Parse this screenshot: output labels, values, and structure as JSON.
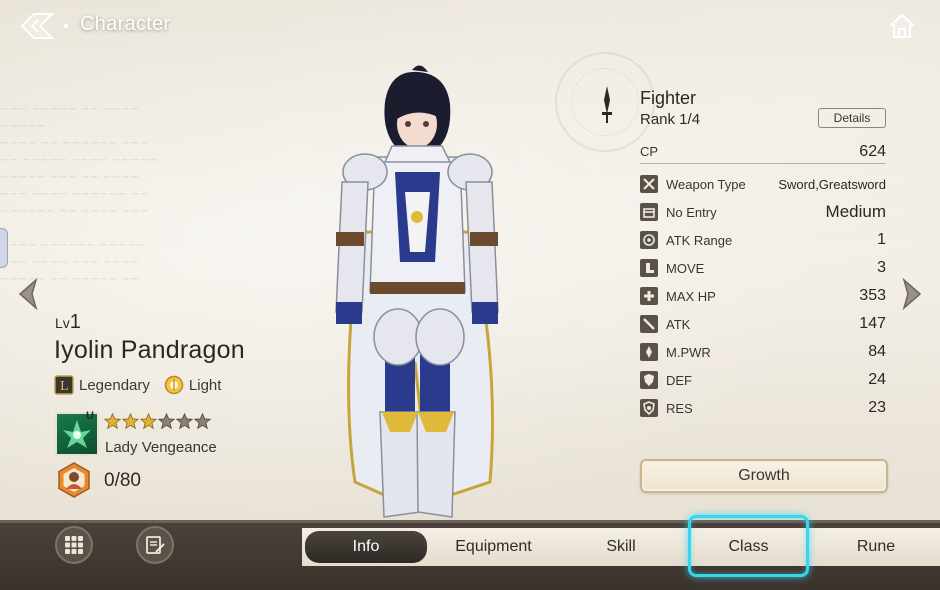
{
  "header": {
    "title": "Character"
  },
  "character": {
    "level_label": "Lv",
    "level": "1",
    "name": "Iyolin Pandragon",
    "rarity": "Legendary",
    "element": "Light",
    "skill": {
      "badge": "U",
      "stars_filled": 3,
      "stars_total": 6,
      "name": "Lady Vengeance"
    },
    "trust": "0/80"
  },
  "class_panel": {
    "class_name": "Fighter",
    "rank": "Rank 1/4",
    "details_label": "Details",
    "cp_label": "CP",
    "cp_value": "624",
    "stats": [
      {
        "label": "Weapon Type",
        "value": "Sword,Greatsword",
        "icon": "weapon-type-icon"
      },
      {
        "label": "No Entry",
        "value": "Medium",
        "icon": "no-entry-icon"
      },
      {
        "label": "ATK Range",
        "value": "1",
        "icon": "atk-range-icon"
      },
      {
        "label": "MOVE",
        "value": "3",
        "icon": "move-icon"
      },
      {
        "label": "MAX HP",
        "value": "353",
        "icon": "max-hp-icon"
      },
      {
        "label": "ATK",
        "value": "147",
        "icon": "atk-icon"
      },
      {
        "label": "M.PWR",
        "value": "84",
        "icon": "mpwr-icon"
      },
      {
        "label": "DEF",
        "value": "24",
        "icon": "def-icon"
      },
      {
        "label": "RES",
        "value": "23",
        "icon": "res-icon"
      }
    ],
    "growth_label": "Growth"
  },
  "tabs": [
    {
      "label": "Info",
      "active": true
    },
    {
      "label": "Equipment",
      "active": false
    },
    {
      "label": "Skill",
      "active": false
    },
    {
      "label": "Class",
      "active": false,
      "highlighted": true
    },
    {
      "label": "Rune",
      "active": false
    }
  ],
  "colors": {
    "highlight": "#36d5f0",
    "active_tab": "#2e2924",
    "star_filled": "#e1b23a",
    "star_empty": "#8a8175"
  }
}
